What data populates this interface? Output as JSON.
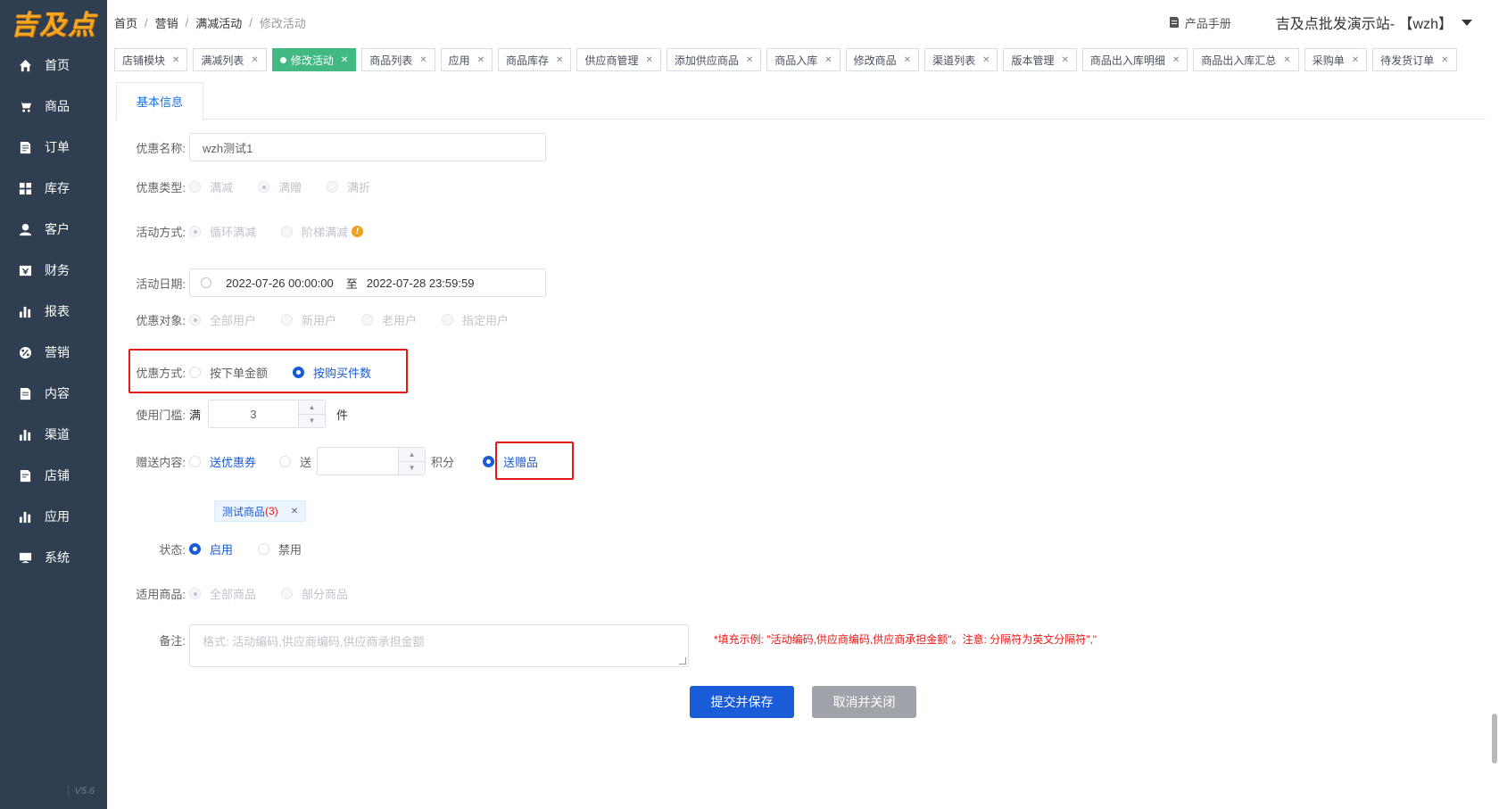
{
  "logo": "吉及点",
  "version": "V5.6",
  "sidebar": {
    "items": [
      {
        "label": "首页",
        "icon": "home-icon"
      },
      {
        "label": "商品",
        "icon": "cart-icon"
      },
      {
        "label": "订单",
        "icon": "order-icon"
      },
      {
        "label": "库存",
        "icon": "grid-icon"
      },
      {
        "label": "客户",
        "icon": "user-icon"
      },
      {
        "label": "财务",
        "icon": "finance-icon"
      },
      {
        "label": "报表",
        "icon": "bar-chart-icon"
      },
      {
        "label": "营销",
        "icon": "percent-icon"
      },
      {
        "label": "内容",
        "icon": "document-icon"
      },
      {
        "label": "渠道",
        "icon": "bar-chart-icon"
      },
      {
        "label": "店铺",
        "icon": "store-icon"
      },
      {
        "label": "应用",
        "icon": "bar-chart-icon"
      },
      {
        "label": "系统",
        "icon": "monitor-icon"
      }
    ]
  },
  "breadcrumb": [
    "首页",
    "营销",
    "满减活动",
    "修改活动"
  ],
  "header": {
    "manual": "产品手册",
    "site": "吉及点批发演示站- 【wzh】"
  },
  "tabs": [
    {
      "label": "店铺模块",
      "active": false
    },
    {
      "label": "满减列表",
      "active": false
    },
    {
      "label": "修改活动",
      "active": true
    },
    {
      "label": "商品列表",
      "active": false
    },
    {
      "label": "应用",
      "active": false
    },
    {
      "label": "商品库存",
      "active": false
    },
    {
      "label": "供应商管理",
      "active": false
    },
    {
      "label": "添加供应商品",
      "active": false
    },
    {
      "label": "商品入库",
      "active": false
    },
    {
      "label": "修改商品",
      "active": false
    },
    {
      "label": "渠道列表",
      "active": false
    },
    {
      "label": "版本管理",
      "active": false
    },
    {
      "label": "商品出入库明细",
      "active": false
    },
    {
      "label": "商品出入库汇总",
      "active": false
    },
    {
      "label": "采购单",
      "active": false
    },
    {
      "label": "待发货订单",
      "active": false
    }
  ],
  "form": {
    "subtab": "基本信息",
    "name": {
      "label": "优惠名称:",
      "value": "wzh测试1"
    },
    "type": {
      "label": "优惠类型:",
      "options": [
        "满减",
        "满赠",
        "满折"
      ]
    },
    "mode": {
      "label": "活动方式:",
      "options": [
        "循环满减",
        "阶梯满减"
      ]
    },
    "date": {
      "label": "活动日期:",
      "start": "2022-07-26 00:00:00",
      "sep": "至",
      "end": "2022-07-28 23:59:59"
    },
    "target": {
      "label": "优惠对象:",
      "options": [
        "全部用户",
        "新用户",
        "老用户",
        "指定用户"
      ]
    },
    "method": {
      "label": "优惠方式:",
      "options": [
        "按下单金额",
        "按购买件数"
      ]
    },
    "threshold": {
      "label": "使用门槛:",
      "prefix": "满",
      "value": "3",
      "suffix": "件"
    },
    "gift": {
      "label": "赠送内容:",
      "coupon": "送优惠券",
      "points_prefix": "送",
      "points_suffix": "积分",
      "goods": "送赠品"
    },
    "gift_tag": {
      "name": "测试商品",
      "count": "(3)"
    },
    "status": {
      "label": "状态:",
      "options": [
        "启用",
        "禁用"
      ]
    },
    "scope": {
      "label": "适用商品:",
      "options": [
        "全部商品",
        "部分商品"
      ]
    },
    "remark": {
      "label": "备注:",
      "placeholder": "格式: 活动编码,供应商编码,供应商承担金额",
      "hint": "*填充示例: \"活动编码,供应商编码,供应商承担金额\"。注意: 分隔符为英文分隔符\",\""
    }
  },
  "buttons": {
    "submit": "提交并保存",
    "cancel": "取消并关闭"
  }
}
